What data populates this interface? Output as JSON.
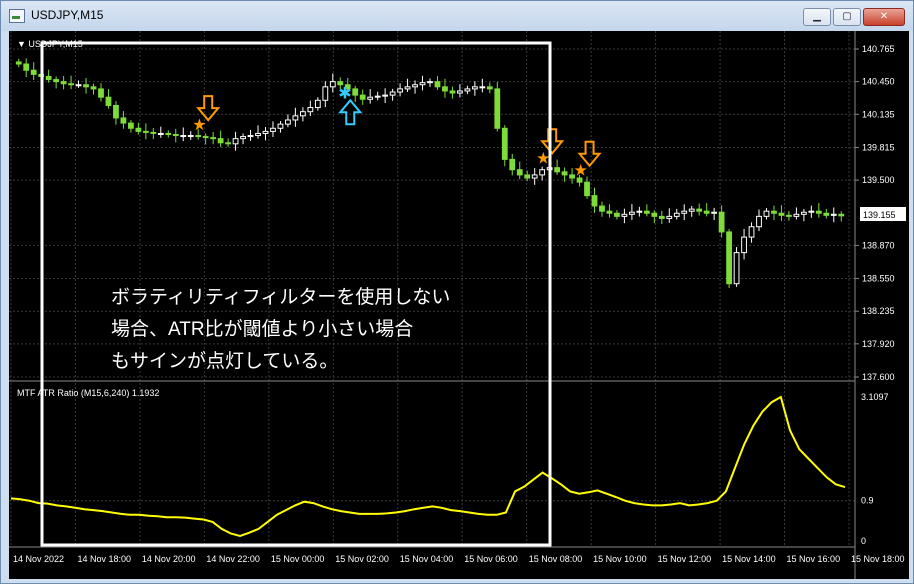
{
  "window": {
    "title": "USDJPY,M15",
    "buttons": {
      "minimize": "▁",
      "maximize": "▢",
      "close": "✕"
    }
  },
  "main_panel": {
    "symbol_label": "▼ USDJPY,M15",
    "price_labels": [
      "140.765",
      "140.450",
      "140.135",
      "139.815",
      "139.500",
      "138.870",
      "138.550",
      "138.235",
      "137.920",
      "137.600"
    ],
    "current_price": "139.155"
  },
  "indicator_panel": {
    "label": "MTF ATR Ratio (M15,6,240) 1.1932",
    "scale_labels": [
      "3.1097",
      "0.9",
      "0"
    ]
  },
  "time_labels": [
    "14 Nov 2022",
    "14 Nov 18:00",
    "14 Nov 20:00",
    "14 Nov 22:00",
    "15 Nov 00:00",
    "15 Nov 02:00",
    "15 Nov 04:00",
    "15 Nov 06:00",
    "15 Nov 08:00",
    "15 Nov 10:00",
    "15 Nov 12:00",
    "15 Nov 14:00",
    "15 Nov 16:00",
    "15 Nov 18:00"
  ],
  "annotation": {
    "lines": [
      "ボラティリティフィルターを使用しない",
      "場合、ATR比が閾値より小さい場合",
      "もサインが点灯している。"
    ]
  },
  "colors": {
    "background": "#000000",
    "grid": "#3a3a3a",
    "bull_candle": "#ffffff",
    "bear_candle": "#7ddc3a",
    "atr_line": "#ffff00",
    "sell_arrow": "#ff9900",
    "buy_arrow": "#33ccff",
    "highlight_box": "#ffffff"
  },
  "chart_data": {
    "type": "candlestick",
    "price_close": [
      140.62,
      140.56,
      140.52,
      140.5,
      140.47,
      140.45,
      140.43,
      140.42,
      140.42,
      140.4,
      140.38,
      140.3,
      140.22,
      140.1,
      140.05,
      140.0,
      139.97,
      139.96,
      139.95,
      139.95,
      139.94,
      139.93,
      139.93,
      139.93,
      139.92,
      139.91,
      139.9,
      139.86,
      139.85,
      139.9,
      139.92,
      139.93,
      139.95,
      139.97,
      140.0,
      140.04,
      140.08,
      140.12,
      140.16,
      140.2,
      140.27,
      140.4,
      140.45,
      140.42,
      140.38,
      140.32,
      140.28,
      140.3,
      140.31,
      140.32,
      140.35,
      140.38,
      140.4,
      140.42,
      140.44,
      140.45,
      140.4,
      140.36,
      140.34,
      140.36,
      140.38,
      140.4,
      140.4,
      140.38,
      140.0,
      139.7,
      139.6,
      139.55,
      139.52,
      139.55,
      139.6,
      139.62,
      139.58,
      139.55,
      139.52,
      139.48,
      139.35,
      139.25,
      139.2,
      139.18,
      139.15,
      139.17,
      139.19,
      139.2,
      139.18,
      139.15,
      139.13,
      139.15,
      139.18,
      139.2,
      139.22,
      139.2,
      139.18,
      139.19,
      139.0,
      138.5,
      138.8,
      138.95,
      139.05,
      139.15,
      139.2,
      139.18,
      139.16,
      139.15,
      139.17,
      139.19,
      139.2,
      139.18,
      139.16,
      139.17,
      139.155
    ],
    "atr_ratio": [
      0.95,
      0.93,
      0.9,
      0.85,
      0.84,
      0.8,
      0.78,
      0.75,
      0.72,
      0.7,
      0.68,
      0.65,
      0.62,
      0.6,
      0.6,
      0.58,
      0.57,
      0.55,
      0.55,
      0.54,
      0.52,
      0.5,
      0.45,
      0.3,
      0.2,
      0.15,
      0.22,
      0.3,
      0.45,
      0.6,
      0.7,
      0.8,
      0.88,
      0.85,
      0.78,
      0.72,
      0.68,
      0.65,
      0.62,
      0.62,
      0.62,
      0.63,
      0.65,
      0.68,
      0.72,
      0.75,
      0.78,
      0.75,
      0.7,
      0.68,
      0.65,
      0.62,
      0.6,
      0.6,
      0.65,
      1.1,
      1.2,
      1.35,
      1.5,
      1.38,
      1.25,
      1.1,
      1.05,
      1.08,
      1.12,
      1.05,
      0.98,
      0.9,
      0.85,
      0.82,
      0.8,
      0.8,
      0.82,
      0.85,
      0.8,
      0.82,
      0.85,
      0.9,
      1.1,
      1.6,
      2.1,
      2.5,
      2.8,
      3.0,
      3.11,
      2.4,
      2.0,
      1.8,
      1.6,
      1.4,
      1.25,
      1.19
    ],
    "price_range": [
      137.6,
      140.765
    ],
    "atr_range": [
      0,
      3.1097
    ],
    "atr_threshold": 0.9,
    "signals": [
      {
        "type": "sell",
        "index": 24
      },
      {
        "type": "buy",
        "index": 43
      },
      {
        "type": "sell",
        "index": 70
      },
      {
        "type": "sell",
        "index": 75
      }
    ]
  }
}
